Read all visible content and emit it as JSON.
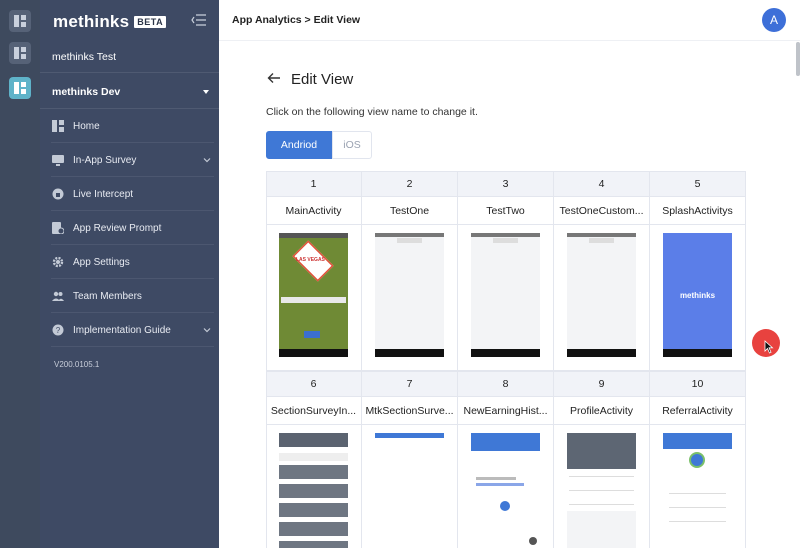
{
  "brand": {
    "logo": "methinks",
    "badge": "BETA"
  },
  "sidebar": {
    "org": "methinks Test",
    "project": "methinks Dev",
    "items": [
      {
        "label": "Home",
        "icon": "home-icon"
      },
      {
        "label": "In-App Survey",
        "icon": "survey-icon",
        "expandable": true
      },
      {
        "label": "Live Intercept",
        "icon": "intercept-icon"
      },
      {
        "label": "App Review Prompt",
        "icon": "review-icon"
      },
      {
        "label": "App Settings",
        "icon": "gear-icon"
      },
      {
        "label": "Team Members",
        "icon": "team-icon"
      },
      {
        "label": "Implementation Guide",
        "icon": "help-icon",
        "expandable": true
      }
    ],
    "version": "V200.0105.1"
  },
  "header": {
    "breadcrumb": "App Analytics > Edit View",
    "avatar": "A"
  },
  "page": {
    "title": "Edit View",
    "instruction": "Click on the following view name to change it.",
    "tabs": [
      {
        "label": "Andriod",
        "active": true
      },
      {
        "label": "iOS",
        "active": false
      }
    ]
  },
  "views": [
    {
      "num": "1",
      "name": "MainActivity",
      "thumb": "vegas"
    },
    {
      "num": "2",
      "name": "TestOne",
      "thumb": "blank"
    },
    {
      "num": "3",
      "name": "TestTwo",
      "thumb": "blank"
    },
    {
      "num": "4",
      "name": "TestOneCustom...",
      "thumb": "blank"
    },
    {
      "num": "5",
      "name": "SplashActivitys",
      "thumb": "splash",
      "thumb_text": "methinks"
    },
    {
      "num": "6",
      "name": "SectionSurveyIn...",
      "thumb": "survey"
    },
    {
      "num": "7",
      "name": "MtkSectionSurve...",
      "thumb": "bluebar"
    },
    {
      "num": "8",
      "name": "NewEarningHist...",
      "thumb": "earning"
    },
    {
      "num": "9",
      "name": "ProfileActivity",
      "thumb": "profile"
    },
    {
      "num": "10",
      "name": "ReferralActivity",
      "thumb": "referral"
    }
  ],
  "colors": {
    "primary": "#3f78d6",
    "sidebar": "#3e4a64",
    "rail_active": "#5fb3c9",
    "cursor": "#e8423f"
  }
}
